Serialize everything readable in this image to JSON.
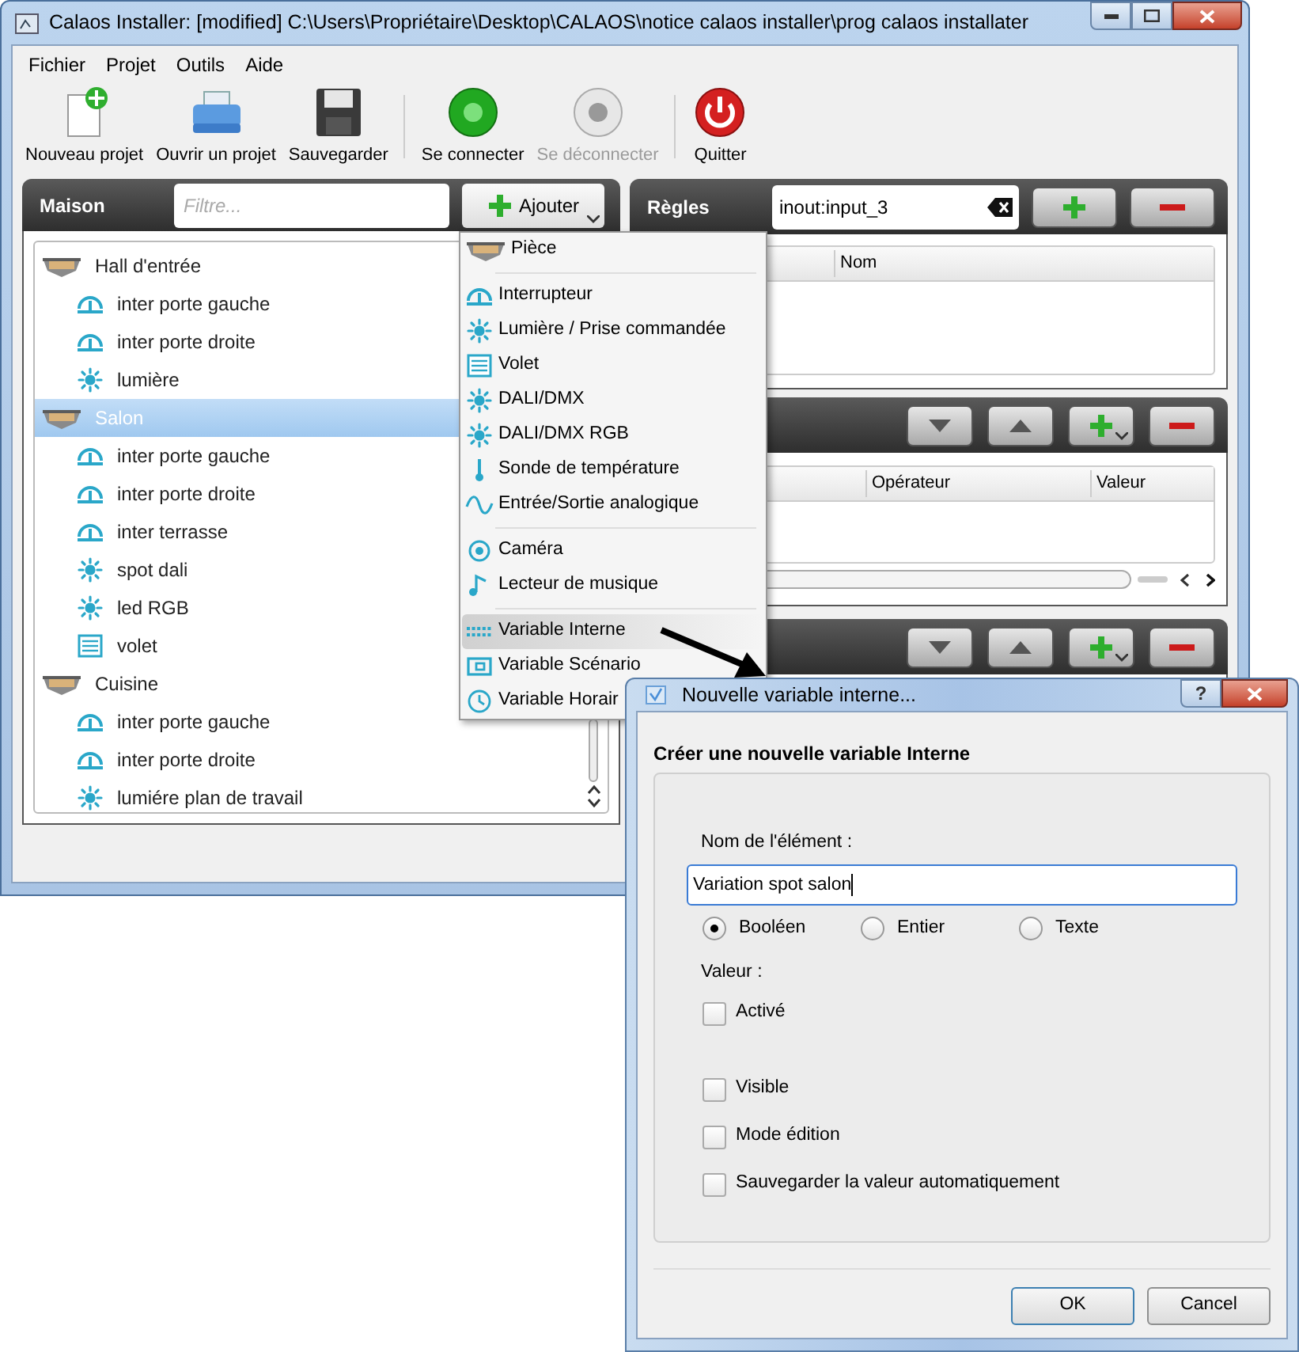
{
  "window": {
    "title": "Calaos Installer: [modified] C:\\Users\\Propriétaire\\Desktop\\CALAOS\\notice calaos installer\\prog calaos installater"
  },
  "menubar": [
    "Fichier",
    "Projet",
    "Outils",
    "Aide"
  ],
  "toolbar": [
    {
      "label": "Nouveau projet",
      "kind": "new",
      "disabled": false
    },
    {
      "label": "Ouvrir un projet",
      "kind": "open",
      "disabled": false
    },
    {
      "label": "Sauvegarder",
      "kind": "save",
      "disabled": false
    },
    {
      "label": "Se connecter",
      "kind": "connect",
      "disabled": false
    },
    {
      "label": "Se déconnecter",
      "kind": "disconnect",
      "disabled": true
    },
    {
      "label": "Quitter",
      "kind": "quit",
      "disabled": false
    }
  ],
  "maison_panel": {
    "title": "Maison",
    "filter": {
      "placeholder": "Filtre..."
    },
    "add_button": "Ajouter",
    "tree": [
      {
        "label": "Hall d'entrée",
        "kind": "room",
        "selected": false,
        "children": [
          {
            "label": "inter porte gauche",
            "kind": "switch",
            "selected": false
          },
          {
            "label": "inter porte droite",
            "kind": "switch",
            "selected": false
          },
          {
            "label": "lumière",
            "kind": "light",
            "selected": false
          }
        ]
      },
      {
        "label": "Salon",
        "kind": "room",
        "selected": true,
        "children": [
          {
            "label": "inter porte gauche",
            "kind": "switch",
            "selected": false
          },
          {
            "label": "inter porte droite",
            "kind": "switch",
            "selected": false
          },
          {
            "label": "inter terrasse",
            "kind": "switch",
            "selected": false
          },
          {
            "label": "spot dali",
            "kind": "light",
            "selected": false
          },
          {
            "label": "led RGB",
            "kind": "light",
            "selected": false
          },
          {
            "label": "volet",
            "kind": "shutter",
            "selected": false
          }
        ]
      },
      {
        "label": "Cuisine",
        "kind": "room",
        "selected": false,
        "children": [
          {
            "label": "inter porte gauche",
            "kind": "switch",
            "selected": false
          },
          {
            "label": "inter porte droite",
            "kind": "switch",
            "selected": false
          },
          {
            "label": "lumiére plan de travail",
            "kind": "light",
            "selected": false
          }
        ]
      }
    ]
  },
  "add_menu": {
    "sections": [
      [
        {
          "label": "Pièce",
          "kind": "room",
          "selected": false
        }
      ],
      [
        {
          "label": "Interrupteur",
          "kind": "switch",
          "selected": false
        },
        {
          "label": "Lumière / Prise commandée",
          "kind": "light",
          "selected": false
        },
        {
          "label": "Volet",
          "kind": "shutter",
          "selected": false
        },
        {
          "label": "DALI/DMX",
          "kind": "light",
          "selected": false
        },
        {
          "label": "DALI/DMX RGB",
          "kind": "light",
          "selected": false
        },
        {
          "label": "Sonde de température",
          "kind": "temp",
          "selected": false
        },
        {
          "label": "Entrée/Sortie analogique",
          "kind": "analog",
          "selected": false
        }
      ],
      [
        {
          "label": "Caméra",
          "kind": "camera",
          "selected": false
        },
        {
          "label": "Lecteur de musique",
          "kind": "music",
          "selected": false
        }
      ],
      [
        {
          "label": "Variable Interne",
          "kind": "internal",
          "selected": true
        },
        {
          "label": "Variable Scénario",
          "kind": "scenario",
          "selected": false
        },
        {
          "label": "Variable Horair",
          "kind": "timer",
          "selected": false
        }
      ]
    ]
  },
  "rules_panel": {
    "title": "Règles",
    "search": {
      "value": "inout:input_3"
    },
    "columns": [
      "Nom"
    ]
  },
  "conditions_panel": {
    "columns": [
      "Opérateur",
      "Valeur"
    ]
  },
  "dialog": {
    "title": "Nouvelle variable interne...",
    "help_button": "?",
    "heading": "Créer une nouvelle variable Interne",
    "name_label": "Nom de l'élément :",
    "name_value": "Variation spot salon",
    "types": [
      {
        "label": "Booléen",
        "selected": true
      },
      {
        "label": "Entier",
        "selected": false
      },
      {
        "label": "Texte",
        "selected": false
      }
    ],
    "value_label": "Valeur :",
    "value_checkbox": {
      "label": "Activé",
      "checked": false
    },
    "options": [
      {
        "label": "Visible",
        "checked": false
      },
      {
        "label": "Mode édition",
        "checked": false
      },
      {
        "label": "Sauvegarder la valeur automatiquement",
        "checked": false
      }
    ],
    "buttons": [
      "OK",
      "Cancel"
    ]
  }
}
